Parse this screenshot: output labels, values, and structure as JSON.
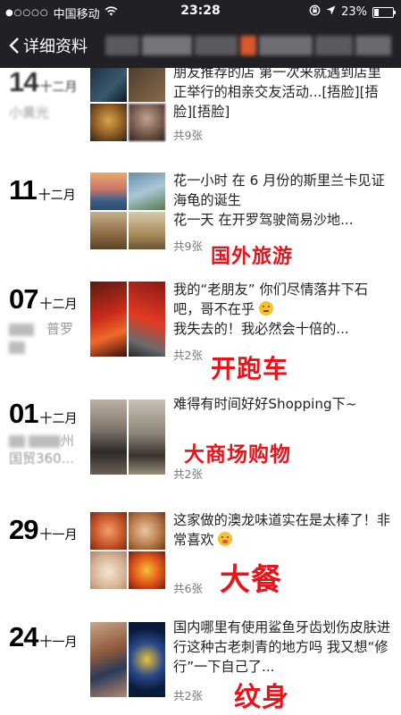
{
  "status_bar": {
    "carrier": "中国移动",
    "time": "23:28",
    "battery": "23%",
    "battery_level": 0.23
  },
  "nav": {
    "back_label": "详细资料"
  },
  "posts": [
    {
      "day": "14",
      "month": "十二月",
      "location": "小黄光",
      "text": "朋友推荐的店 第一次来就遇到店里正举行的相亲交友活动...[捂脸][捂脸][捂脸]",
      "photo_count": "共9张",
      "tag": ""
    },
    {
      "day": "11",
      "month": "十二月",
      "location": "",
      "text": "花一小时 在 6 月份的斯里兰卡见证海龟的诞生\n花一天 在开罗驾驶简易沙地...",
      "photo_count": "共9张",
      "tag": "国外旅游"
    },
    {
      "day": "07",
      "month": "十二月",
      "location": "普罗",
      "text": "我的“老朋友” 你们尽情落井下石吧，哥不在乎",
      "text2": "我失去的！我必然会十倍的...",
      "photo_count": "共2张",
      "tag": "开跑车"
    },
    {
      "day": "01",
      "month": "十二月",
      "location": "州",
      "location2": "国贸360...",
      "text": "难得有时间好好Shopping下~",
      "photo_count": "共2张",
      "tag": "大商场购物"
    },
    {
      "day": "29",
      "month": "十一月",
      "location": "",
      "text": "这家做的澳龙味道实在是太棒了！非常喜欢",
      "photo_count": "共6张",
      "tag": "大餐"
    },
    {
      "day": "24",
      "month": "十一月",
      "location": "",
      "text": "国内哪里有使用鲨鱼牙齿划伤皮肤进行这种古老刺青的地方吗 我又想“修行”一下自己了...",
      "photo_count": "共2张",
      "tag": "纹身"
    }
  ],
  "colors": {
    "status_bg": "#212125",
    "tag_red": "#e8141b"
  }
}
